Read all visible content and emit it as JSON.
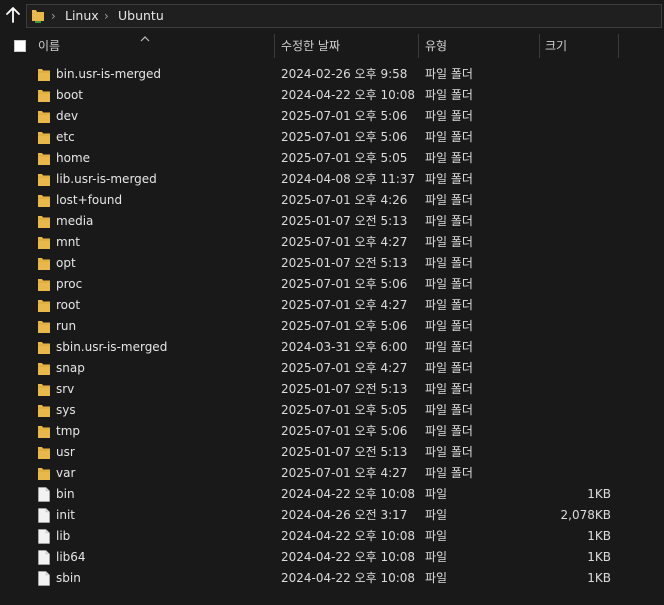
{
  "address_bar": {
    "segments": [
      "Linux",
      "Ubuntu"
    ]
  },
  "columns": {
    "name": "이름",
    "date": "수정한 날짜",
    "type": "유형",
    "size": "크기"
  },
  "icons": {
    "up": "up-arrow-icon",
    "folder": "folder-icon",
    "file": "file-icon",
    "folder_color": "#e8b94a",
    "file_color": "#f2f2f2"
  },
  "rows": [
    {
      "name": "bin.usr-is-merged",
      "date": "2024-02-26 오후 9:58",
      "type": "파일 폴더",
      "size": "",
      "kind": "folder"
    },
    {
      "name": "boot",
      "date": "2024-04-22 오후 10:08",
      "type": "파일 폴더",
      "size": "",
      "kind": "folder"
    },
    {
      "name": "dev",
      "date": "2025-07-01 오후 5:06",
      "type": "파일 폴더",
      "size": "",
      "kind": "folder"
    },
    {
      "name": "etc",
      "date": "2025-07-01 오후 5:06",
      "type": "파일 폴더",
      "size": "",
      "kind": "folder"
    },
    {
      "name": "home",
      "date": "2025-07-01 오후 5:05",
      "type": "파일 폴더",
      "size": "",
      "kind": "folder"
    },
    {
      "name": "lib.usr-is-merged",
      "date": "2024-04-08 오후 11:37",
      "type": "파일 폴더",
      "size": "",
      "kind": "folder"
    },
    {
      "name": "lost+found",
      "date": "2025-07-01 오후 4:26",
      "type": "파일 폴더",
      "size": "",
      "kind": "folder"
    },
    {
      "name": "media",
      "date": "2025-01-07 오전 5:13",
      "type": "파일 폴더",
      "size": "",
      "kind": "folder"
    },
    {
      "name": "mnt",
      "date": "2025-07-01 오후 4:27",
      "type": "파일 폴더",
      "size": "",
      "kind": "folder"
    },
    {
      "name": "opt",
      "date": "2025-01-07 오전 5:13",
      "type": "파일 폴더",
      "size": "",
      "kind": "folder"
    },
    {
      "name": "proc",
      "date": "2025-07-01 오후 5:06",
      "type": "파일 폴더",
      "size": "",
      "kind": "folder"
    },
    {
      "name": "root",
      "date": "2025-07-01 오후 4:27",
      "type": "파일 폴더",
      "size": "",
      "kind": "folder"
    },
    {
      "name": "run",
      "date": "2025-07-01 오후 5:06",
      "type": "파일 폴더",
      "size": "",
      "kind": "folder"
    },
    {
      "name": "sbin.usr-is-merged",
      "date": "2024-03-31 오후 6:00",
      "type": "파일 폴더",
      "size": "",
      "kind": "folder"
    },
    {
      "name": "snap",
      "date": "2025-07-01 오후 4:27",
      "type": "파일 폴더",
      "size": "",
      "kind": "folder"
    },
    {
      "name": "srv",
      "date": "2025-01-07 오전 5:13",
      "type": "파일 폴더",
      "size": "",
      "kind": "folder"
    },
    {
      "name": "sys",
      "date": "2025-07-01 오후 5:05",
      "type": "파일 폴더",
      "size": "",
      "kind": "folder"
    },
    {
      "name": "tmp",
      "date": "2025-07-01 오후 5:06",
      "type": "파일 폴더",
      "size": "",
      "kind": "folder"
    },
    {
      "name": "usr",
      "date": "2025-01-07 오전 5:13",
      "type": "파일 폴더",
      "size": "",
      "kind": "folder"
    },
    {
      "name": "var",
      "date": "2025-07-01 오후 4:27",
      "type": "파일 폴더",
      "size": "",
      "kind": "folder"
    },
    {
      "name": "bin",
      "date": "2024-04-22 오후 10:08",
      "type": "파일",
      "size": "1KB",
      "kind": "file"
    },
    {
      "name": "init",
      "date": "2024-04-26 오전 3:17",
      "type": "파일",
      "size": "2,078KB",
      "kind": "file"
    },
    {
      "name": "lib",
      "date": "2024-04-22 오후 10:08",
      "type": "파일",
      "size": "1KB",
      "kind": "file"
    },
    {
      "name": "lib64",
      "date": "2024-04-22 오후 10:08",
      "type": "파일",
      "size": "1KB",
      "kind": "file"
    },
    {
      "name": "sbin",
      "date": "2024-04-22 오후 10:08",
      "type": "파일",
      "size": "1KB",
      "kind": "file"
    }
  ]
}
